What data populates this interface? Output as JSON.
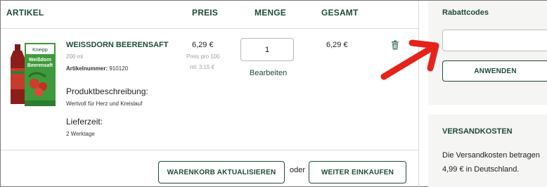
{
  "table": {
    "headers": {
      "article": "ARTIKEL",
      "price": "PREIS",
      "quantity": "MENGE",
      "total": "GESAMT"
    }
  },
  "item": {
    "name": "WEISSDORN BEERENSAFT",
    "size": "200 ml",
    "article_number_label": "Artikelnummer:",
    "article_number": "910120",
    "description_label": "Produktbeschreibung:",
    "description": "Wertvoll für Herz und Kreislauf",
    "delivery_label": "Lieferzeit:",
    "delivery": "2 Werktage",
    "price": "6,29 €",
    "unit_price_line1": "Preis pro 100",
    "unit_price_line2": "ml: 3,15 €",
    "quantity": "1",
    "edit_label": "Bearbeiten",
    "total": "6,29 €",
    "package_brand": "Kneipp",
    "package_title_line1": "Weißdorn",
    "package_title_line2": "Beerensaft"
  },
  "actions": {
    "update_cart": "WARENKORB AKTUALISIEREN",
    "or": "oder",
    "continue_shopping": "WEITER EINKAUFEN"
  },
  "sidebar": {
    "coupon_title": "Rabattcodes",
    "coupon_value": "",
    "apply_button": "ANWENDEN",
    "shipping_title": "VERSANDKOSTEN",
    "shipping_line1": "Die Versandkosten betragen",
    "shipping_line2": "4,99 € in Deutschland."
  },
  "colors": {
    "brand_green": "#1d4c36",
    "annotation_arrow": "#e5231b"
  }
}
